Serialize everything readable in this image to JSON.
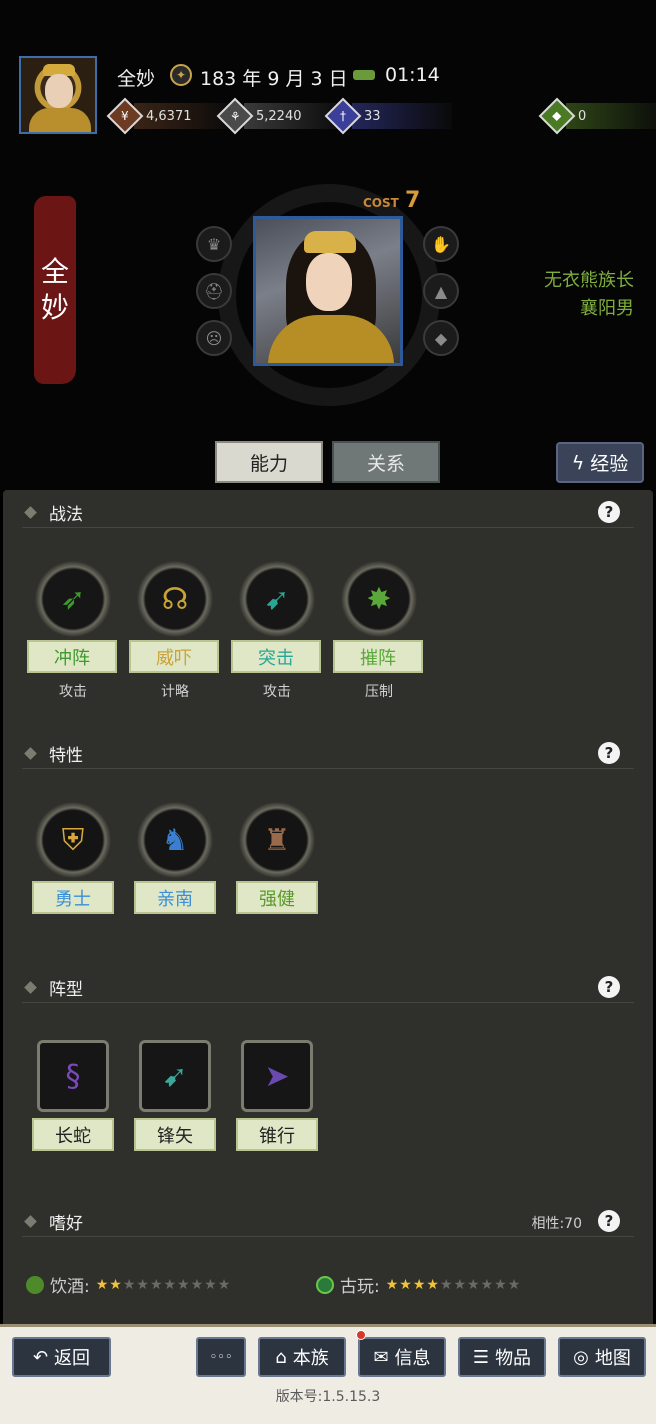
{
  "header": {
    "player_name": "全妙",
    "date": "183 年 9 月 3 日",
    "time": "01:14",
    "resources": [
      {
        "icon": "money-icon",
        "value": "4,6371"
      },
      {
        "icon": "food-icon",
        "value": "5,2240"
      },
      {
        "icon": "gem-icon",
        "value": "33"
      },
      {
        "icon": "potion-icon",
        "value": "0"
      }
    ]
  },
  "character": {
    "name_char1": "全",
    "name_char2": "妙",
    "cost_label": "COST",
    "cost_value": "7",
    "title1": "无衣熊族长",
    "title2": "襄阳男"
  },
  "tabs": {
    "ability": "能力",
    "relation": "关系",
    "exp": "经验"
  },
  "tactics": {
    "title": "战法",
    "items": [
      {
        "name": "冲阵",
        "type": "攻击",
        "color": "#3f9a2e"
      },
      {
        "name": "威吓",
        "type": "计略",
        "color": "#c9a33a"
      },
      {
        "name": "突击",
        "type": "攻击",
        "color": "#2aa596"
      },
      {
        "name": "摧阵",
        "type": "压制",
        "color": "#5aa83a"
      }
    ]
  },
  "traits": {
    "title": "特性",
    "items": [
      {
        "name": "勇士",
        "color": "#3a8fd8"
      },
      {
        "name": "亲南",
        "color": "#3a8fd8"
      },
      {
        "name": "强健",
        "color": "#5a9a2a"
      }
    ]
  },
  "formations": {
    "title": "阵型",
    "items": [
      {
        "name": "长蛇"
      },
      {
        "name": "锋矢"
      },
      {
        "name": "锥行"
      }
    ]
  },
  "preferences": {
    "title": "嗜好",
    "affinity": "相性:70",
    "items": [
      {
        "label": "饮酒:",
        "stars_on": "★★",
        "stars_off": "★★★★★★★★"
      },
      {
        "label": "古玩:",
        "stars_on": "★★★★",
        "stars_off": "★★★★★★"
      }
    ]
  },
  "bottom": {
    "back": "返回",
    "more": "◦◦◦",
    "clan": "本族",
    "info": "信息",
    "items": "物品",
    "map": "地图",
    "version": "版本号:1.5.15.3"
  }
}
